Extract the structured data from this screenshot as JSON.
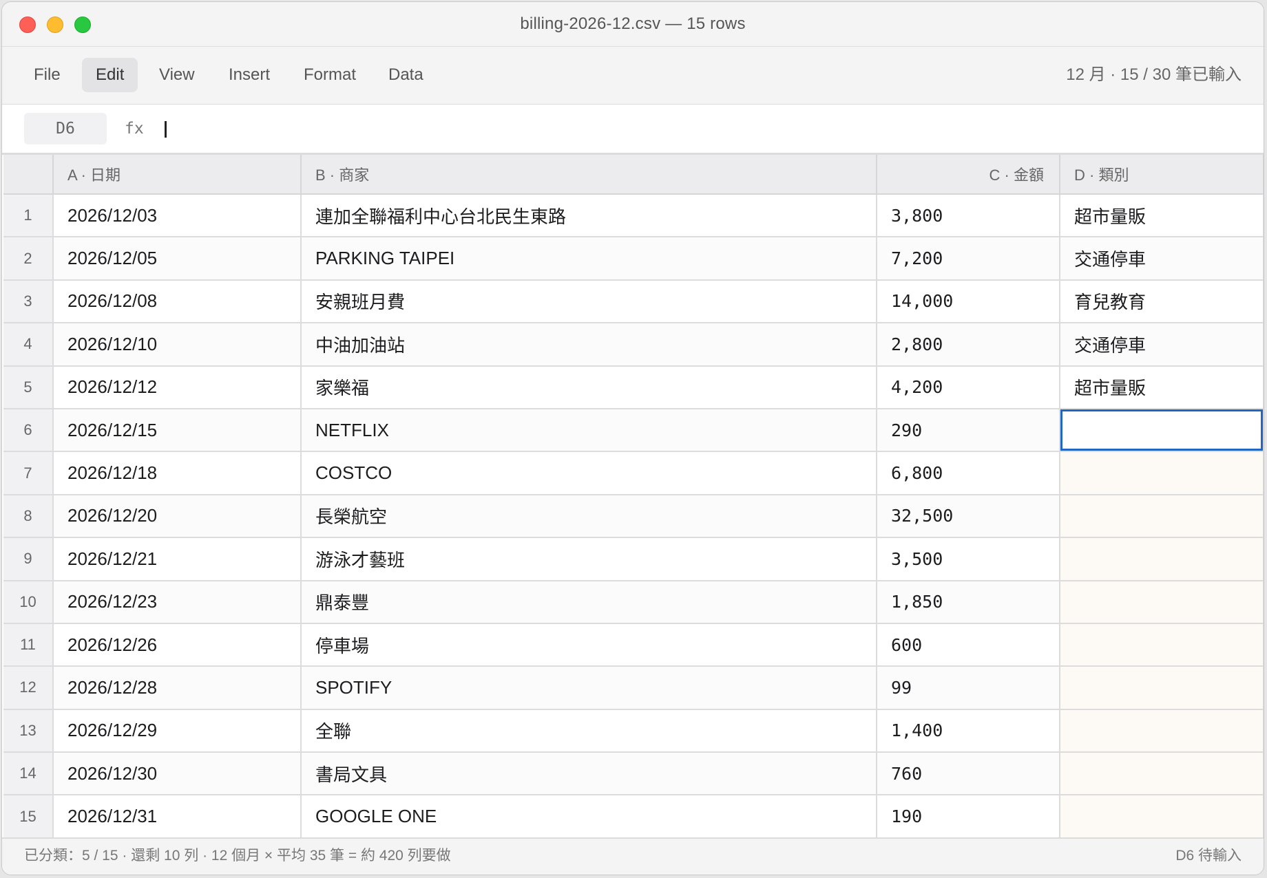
{
  "window": {
    "title": "billing-2026-12.csv — 15 rows"
  },
  "menu": {
    "items": [
      "File",
      "Edit",
      "View",
      "Insert",
      "Format",
      "Data"
    ],
    "active": "Edit",
    "status": "12 月 · 15 / 30 筆已輸入"
  },
  "formula_bar": {
    "cell_ref": "D6",
    "fx_label": "fx",
    "value": ""
  },
  "columns": [
    "A · 日期",
    "B · 商家",
    "C · 金額",
    "D · 類別"
  ],
  "rows": [
    {
      "n": "1",
      "date": "2026/12/03",
      "merchant": "連加全聯福利中心台北民生東路",
      "amount": "3,800",
      "category": "超市量販"
    },
    {
      "n": "2",
      "date": "2026/12/05",
      "merchant": "PARKING TAIPEI",
      "amount": "7,200",
      "category": "交通停車"
    },
    {
      "n": "3",
      "date": "2026/12/08",
      "merchant": "安親班月費",
      "amount": "14,000",
      "category": "育兒教育"
    },
    {
      "n": "4",
      "date": "2026/12/10",
      "merchant": "中油加油站",
      "amount": "2,800",
      "category": "交通停車"
    },
    {
      "n": "5",
      "date": "2026/12/12",
      "merchant": "家樂福",
      "amount": "4,200",
      "category": "超市量販"
    },
    {
      "n": "6",
      "date": "2026/12/15",
      "merchant": "NETFLIX",
      "amount": "290",
      "category": ""
    },
    {
      "n": "7",
      "date": "2026/12/18",
      "merchant": "COSTCO",
      "amount": "6,800",
      "category": ""
    },
    {
      "n": "8",
      "date": "2026/12/20",
      "merchant": "長榮航空",
      "amount": "32,500",
      "category": ""
    },
    {
      "n": "9",
      "date": "2026/12/21",
      "merchant": "游泳才藝班",
      "amount": "3,500",
      "category": ""
    },
    {
      "n": "10",
      "date": "2026/12/23",
      "merchant": "鼎泰豐",
      "amount": "1,850",
      "category": ""
    },
    {
      "n": "11",
      "date": "2026/12/26",
      "merchant": "停車場",
      "amount": "600",
      "category": ""
    },
    {
      "n": "12",
      "date": "2026/12/28",
      "merchant": "SPOTIFY",
      "amount": "99",
      "category": ""
    },
    {
      "n": "13",
      "date": "2026/12/29",
      "merchant": "全聯",
      "amount": "1,400",
      "category": ""
    },
    {
      "n": "14",
      "date": "2026/12/30",
      "merchant": "書局文具",
      "amount": "760",
      "category": ""
    },
    {
      "n": "15",
      "date": "2026/12/31",
      "merchant": "GOOGLE ONE",
      "amount": "190",
      "category": ""
    }
  ],
  "selected_row": "6",
  "status_bar": {
    "left": "已分類：5 / 15 · 還剩 10 列 · 12 個月 × 平均 35 筆 = 約 420 列要做",
    "right": "D6 待輸入"
  },
  "colors": {
    "selection": "#2166c2",
    "pending_cell": "#fdf9f5"
  }
}
